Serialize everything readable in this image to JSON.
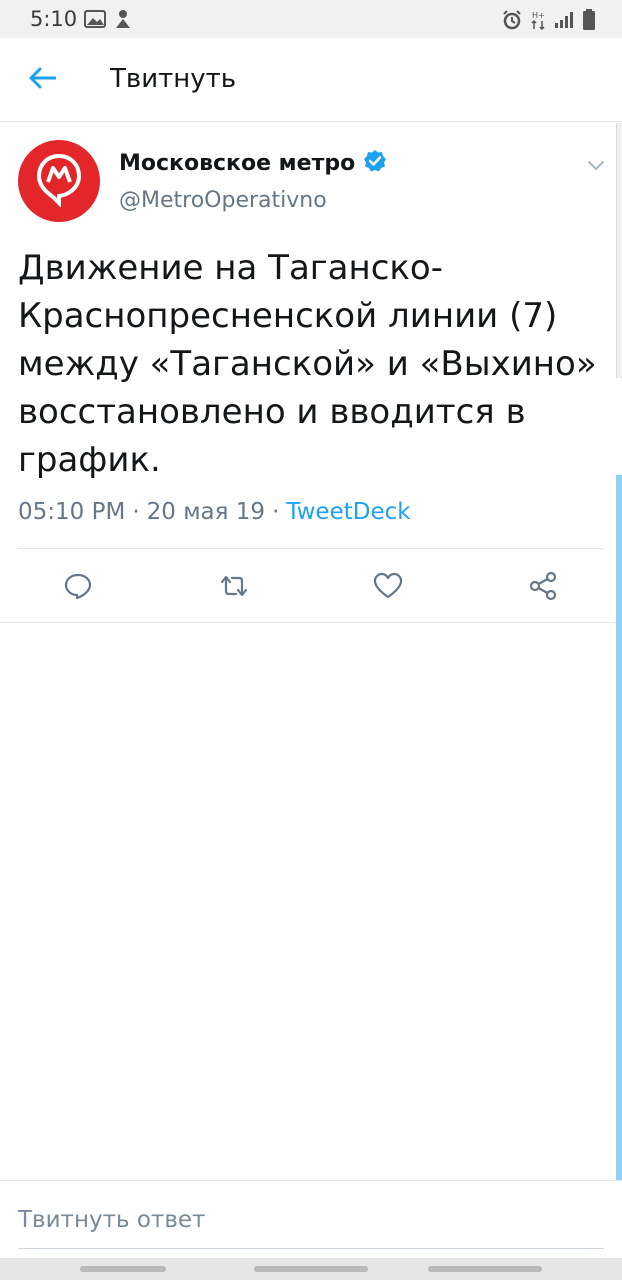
{
  "status_bar": {
    "time": "5:10",
    "left_icons": [
      "image-icon",
      "silent-icon"
    ],
    "right_icons": [
      "alarm-icon",
      "network-icon",
      "signal-icon",
      "battery-icon"
    ]
  },
  "app_bar": {
    "title": "Твитнуть",
    "back_icon": "arrow-left-icon"
  },
  "tweet": {
    "author_name": "Московское метро",
    "verified": true,
    "handle": "@MetroOperativno",
    "text": "Движение на Таганско-Краснопресненской линии (7) между «Таганской» и «Выхино» восстановлено и вводится в график.",
    "time": "05:10 PM",
    "separator": "·",
    "date": "20 мая 19",
    "source": "TweetDeck",
    "actions": [
      "reply-icon",
      "retweet-icon",
      "like-icon",
      "share-icon"
    ]
  },
  "reply": {
    "placeholder": "Твитнуть ответ"
  },
  "colors": {
    "accent": "#1da1f2",
    "avatar_red": "#e32629",
    "secondary_text": "#657786",
    "divider": "#e1e8ed"
  }
}
